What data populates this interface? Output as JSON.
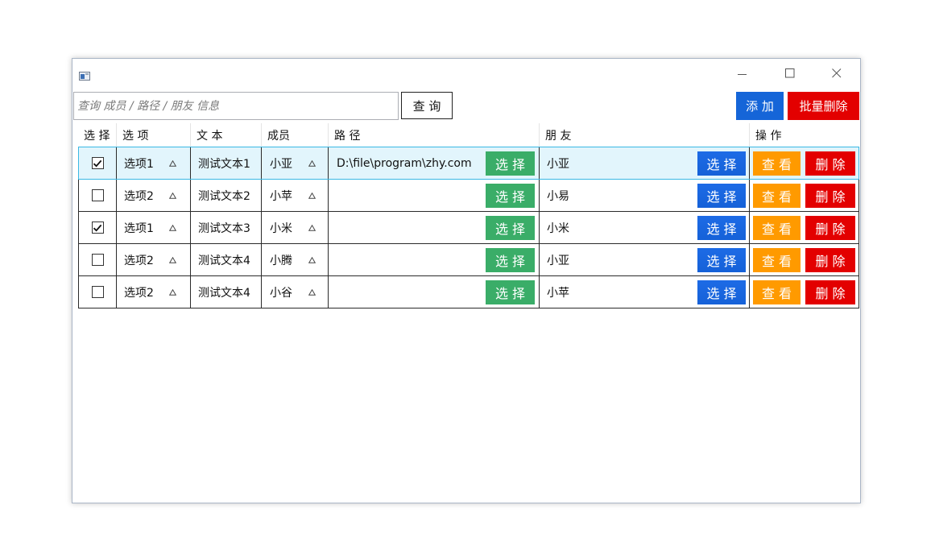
{
  "window": {
    "icon": "app-icon",
    "controls": [
      "minimize-icon",
      "maximize-icon",
      "close-icon"
    ]
  },
  "search": {
    "placeholder": "查询 成员 / 路径 / 朋友 信息",
    "value": "",
    "button_label": "查 询"
  },
  "toolbar": {
    "add_label": "添 加",
    "batch_delete_label": "批量删除"
  },
  "table": {
    "headers": [
      "选 择",
      "选 项",
      "文 本",
      "成员",
      "路 径",
      "朋 友",
      "操 作"
    ],
    "rows": [
      {
        "checked": true,
        "selected": true,
        "option": "选项1",
        "text": "测试文本1",
        "member": "小亚",
        "path": "D:\\file\\program\\zhy.com",
        "friend": "小亚"
      },
      {
        "checked": false,
        "selected": false,
        "option": "选项2",
        "text": "测试文本2",
        "member": "小苹",
        "path": "",
        "friend": "小易"
      },
      {
        "checked": true,
        "selected": false,
        "option": "选项1",
        "text": "测试文本3",
        "member": "小米",
        "path": "",
        "friend": "小米"
      },
      {
        "checked": false,
        "selected": false,
        "option": "选项2",
        "text": "测试文本4",
        "member": "小腾",
        "path": "",
        "friend": "小亚"
      },
      {
        "checked": false,
        "selected": false,
        "option": "选项2",
        "text": "测试文本4",
        "member": "小谷",
        "path": "",
        "friend": "小苹"
      }
    ],
    "row_buttons": {
      "path_select": "选 择",
      "friend_select": "选 择",
      "view": "查 看",
      "delete": "删 除"
    }
  },
  "icons": {
    "dropdown": "triangle-up-icon",
    "check": "checkmark-icon"
  },
  "colors": {
    "add": "#1565d8",
    "danger": "#e30000",
    "select_path": "#3aad68",
    "select_friend": "#1561d8",
    "view": "#ff9a00",
    "selected_row_bg": "#e2f5fc",
    "selected_row_border": "#3ab8e4"
  }
}
